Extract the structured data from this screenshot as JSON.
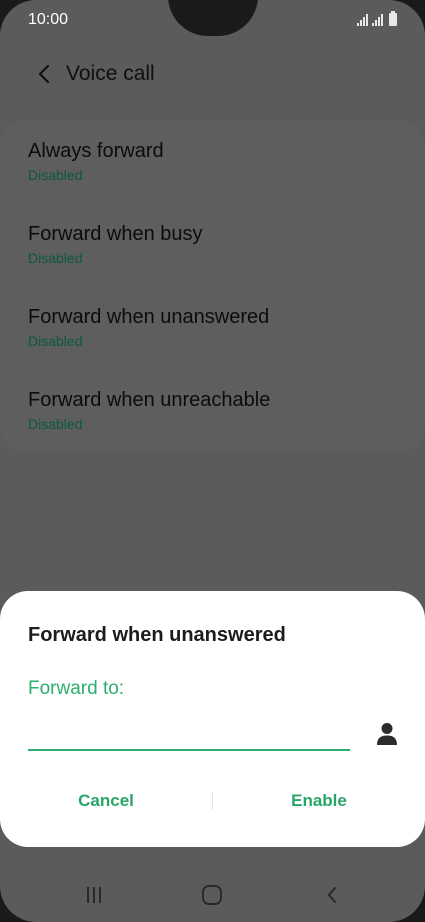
{
  "status_bar": {
    "time": "10:00"
  },
  "header": {
    "title": "Voice call"
  },
  "list": {
    "items": [
      {
        "title": "Always forward",
        "status": "Disabled"
      },
      {
        "title": "Forward when busy",
        "status": "Disabled"
      },
      {
        "title": "Forward when unanswered",
        "status": "Disabled"
      },
      {
        "title": "Forward when unreachable",
        "status": "Disabled"
      }
    ]
  },
  "dialog": {
    "title": "Forward when unanswered",
    "field_label": "Forward to:",
    "field_value": "",
    "cancel_label": "Cancel",
    "enable_label": "Enable"
  },
  "icons": {
    "back": "back-arrow-icon",
    "contact": "contact-person-icon",
    "recents": "recents-icon",
    "home": "home-icon",
    "nav_back": "nav-back-icon"
  },
  "colors": {
    "accent": "#2eae6e",
    "status_text": "#0b5a3c",
    "dim_background": "#5b5b5b",
    "dialog_background": "#ffffff"
  }
}
